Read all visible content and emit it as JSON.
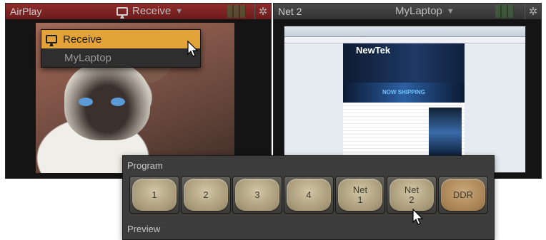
{
  "left_monitor": {
    "name": "AirPlay",
    "source_label": "Receive",
    "dropdown": {
      "items": [
        {
          "label": "Receive",
          "selected": true
        },
        {
          "label": "MyLaptop",
          "selected": false
        }
      ]
    }
  },
  "right_monitor": {
    "name": "Net 2",
    "source_label": "MyLaptop",
    "site_logo": "NewTek",
    "site_banner": "NOW SHIPPING"
  },
  "switcher": {
    "program_label": "Program",
    "preview_label": "Preview",
    "buttons": [
      {
        "label": "1"
      },
      {
        "label": "2"
      },
      {
        "label": "3"
      },
      {
        "label": "4"
      },
      {
        "label": "Net\n1"
      },
      {
        "label": "Net\n2"
      },
      {
        "label": "DDR"
      }
    ]
  },
  "colors": {
    "airplay_titlebar": "#8e2b2b",
    "dropdown_selected": "#e3a338"
  }
}
